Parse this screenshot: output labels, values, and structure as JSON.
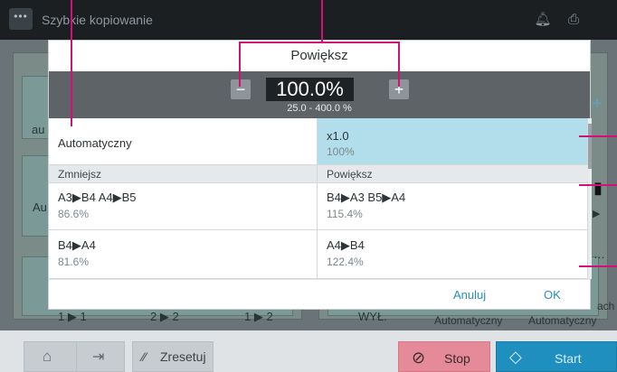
{
  "app": {
    "title": "Szybkie kopiowanie",
    "menu_icon": "ellipsis-icon",
    "bell_icon": "bell-icon",
    "device_icon": "device-icon"
  },
  "background": {
    "texts": [
      "au",
      "Au",
      "1 ▶ 1",
      "2 ▶ 2",
      "1 ▶ 2",
      "WYŁ.",
      "Automatyczny",
      "Automatyczny",
      "ach",
      "…"
    ]
  },
  "dialog": {
    "title": "Powiększ",
    "ratio_value": "100.0%",
    "ratio_range": "25.0  -  400.0  %",
    "minus_label": "−",
    "plus_label": "+",
    "items": {
      "auto": {
        "label": "Automatyczny"
      },
      "x1": {
        "label": "x1.0",
        "value": "100%"
      },
      "reduce_header": "Zmniejsz",
      "enlarge_header": "Powiększ",
      "r1": {
        "label": "A3▶B4  A4▶B5",
        "value": "86.6%"
      },
      "e1": {
        "label": "B4▶A3  B5▶A4",
        "value": "115.4%"
      },
      "r2": {
        "label": "B4▶A4",
        "value": "81.6%"
      },
      "e2": {
        "label": "A4▶B4",
        "value": "122.4%"
      }
    },
    "cancel_label": "Anuluj",
    "ok_label": "OK"
  },
  "bottombar": {
    "home_icon": "home-icon",
    "logout_icon": "logout-icon",
    "reset_label": "Zresetuj",
    "stop_label": "Stop",
    "start_label": "Start"
  },
  "colors": {
    "accent": "#2a8fb8",
    "callout": "#d2107a",
    "selected": "#b2deeb",
    "stop": "#e58a98",
    "start": "#1f8fbf"
  }
}
